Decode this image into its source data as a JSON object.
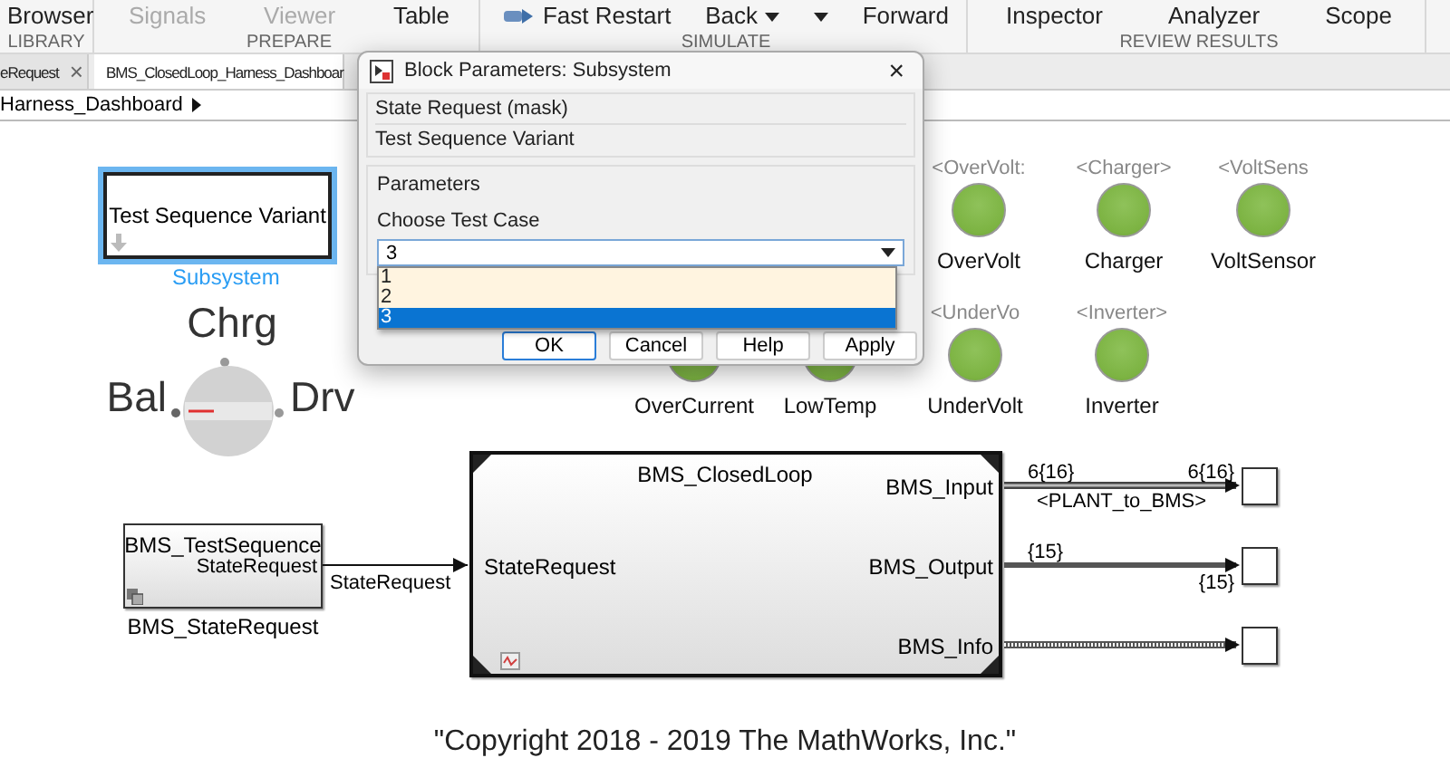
{
  "toolstrip": {
    "sections": [
      {
        "label": "LIBRARY",
        "buttons": [
          {
            "label": "Browser",
            "disabled": false,
            "caret": false
          }
        ]
      },
      {
        "label": "PREPARE",
        "buttons": [
          {
            "label": "Signals",
            "disabled": true,
            "caret": false
          },
          {
            "label": "Viewer",
            "disabled": true,
            "caret": false
          },
          {
            "label": "Table",
            "disabled": false,
            "caret": false
          }
        ]
      },
      {
        "label": "SIMULATE",
        "buttons": [
          {
            "label": "Fast Restart",
            "disabled": false,
            "caret": false,
            "kind": "restart"
          },
          {
            "label": "Back",
            "disabled": false,
            "caret": true
          },
          {
            "disabled": false,
            "caret": true
          },
          {
            "label": "Forward",
            "disabled": false,
            "caret": false
          }
        ]
      },
      {
        "label": "REVIEW RESULTS",
        "buttons": [
          {
            "label": "Inspector",
            "disabled": false,
            "caret": false
          },
          {
            "label": "Analyzer",
            "disabled": false,
            "caret": false
          },
          {
            "label": "Scope",
            "disabled": false,
            "caret": false
          }
        ]
      }
    ]
  },
  "tabs": [
    {
      "label": "eRequest",
      "selected": false,
      "close": "×"
    },
    {
      "label": "BMS_ClosedLoop_Harness_Dashboar",
      "selected": true
    }
  ],
  "breadcrumb": {
    "label": "Harness_Dashboard"
  },
  "canvas": {
    "subsystem": {
      "text": "Test Sequence Variant",
      "name": "Subsystem",
      "selected": true
    },
    "knob": {
      "positions": [
        {
          "label": "Chrg",
          "selected": false
        },
        {
          "label": "Bal",
          "selected": true
        },
        {
          "label": "Drv",
          "selected": false
        }
      ]
    },
    "lamps": [
      {
        "tag": "<OverVolt:",
        "label": "OverVolt",
        "lit": true
      },
      {
        "tag": "<Charger>",
        "label": "Charger",
        "lit": true
      },
      {
        "tag": "<VoltSens",
        "label": "VoltSensor",
        "lit": true
      },
      {
        "label": "OverCurrent",
        "lit": true
      },
      {
        "label": "LowTemp",
        "lit": true
      },
      {
        "tag": "<UnderVo",
        "label": "UnderVolt",
        "lit": true
      },
      {
        "tag": "<Inverter>",
        "label": "Inverter",
        "lit": true
      }
    ],
    "test_block": {
      "title": "BMS_TestSequence",
      "port": "StateRequest",
      "name": "BMS_StateRequest"
    },
    "signal": {
      "label": "StateRequest"
    },
    "model_block": {
      "title": "BMS_ClosedLoop",
      "inport": "StateRequest",
      "outports": [
        "BMS_Input",
        "BMS_Output",
        "BMS_Info"
      ]
    },
    "outputs": [
      {
        "kind": "bus",
        "left": "6{16}",
        "right": "6{16}",
        "below": "<PLANT_to_BMS>"
      },
      {
        "kind": "vector",
        "left": "{15}",
        "right": "{15}"
      },
      {
        "kind": "nonvirtual"
      }
    ],
    "copyright": "\"Copyright 2018 - 2019 The MathWorks, Inc.\""
  },
  "dialog": {
    "title": "Block Parameters: Subsystem",
    "close": "×",
    "mask_title": "State Request (mask)",
    "description": "Test Sequence Variant",
    "group": "Parameters",
    "field_label": "Choose Test Case",
    "value": "3",
    "expanded": true,
    "options": [
      {
        "label": "1",
        "selected": false
      },
      {
        "label": "2",
        "selected": false
      },
      {
        "label": "3",
        "selected": true
      }
    ],
    "buttons": [
      {
        "label": "OK",
        "default": true
      },
      {
        "label": "Cancel",
        "default": false
      },
      {
        "label": "Help",
        "default": false
      },
      {
        "label": "Apply",
        "default": false
      }
    ]
  }
}
